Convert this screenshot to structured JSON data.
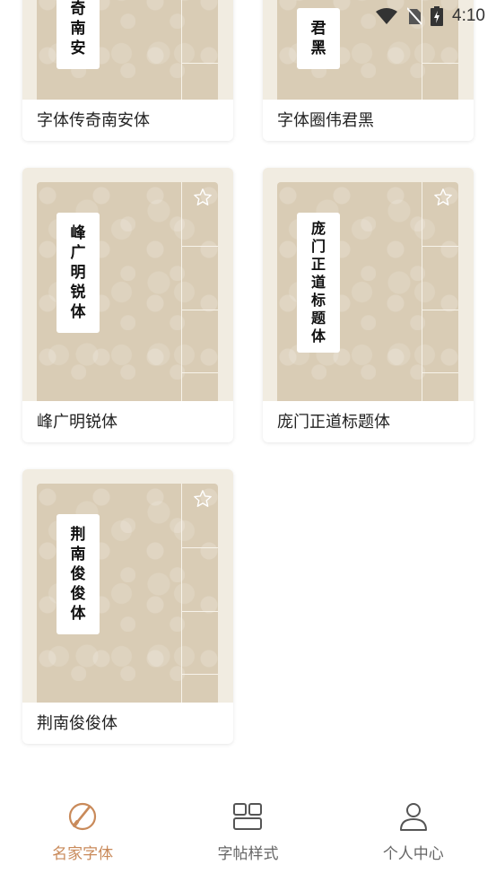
{
  "status_bar": {
    "time": "4:10"
  },
  "cards": [
    {
      "title": "字体传奇南安体",
      "strip": [
        "奇",
        "南",
        "安"
      ]
    },
    {
      "title": "字体圈伟君黑",
      "strip": [
        "君",
        "黑"
      ]
    },
    {
      "title": "峰广明锐体",
      "strip": [
        "峰",
        "广",
        "明",
        "锐",
        "体"
      ]
    },
    {
      "title": "庞门正道标题体",
      "strip": [
        "庞",
        "门",
        "正",
        "道",
        "标",
        "题",
        "体"
      ]
    },
    {
      "title": "荆南俊俊体",
      "strip": [
        "荆",
        "南",
        "俊",
        "俊",
        "体"
      ]
    }
  ],
  "nav": [
    {
      "label": "名家字体",
      "icon": "compass-brush-icon",
      "active": true
    },
    {
      "label": "字帖样式",
      "icon": "grid-layout-icon",
      "active": false
    },
    {
      "label": "个人中心",
      "icon": "user-icon",
      "active": false
    }
  ],
  "colors": {
    "accent": "#c98a5a",
    "cover": "#d9ccb5",
    "cover_bg": "#f1ece1"
  }
}
